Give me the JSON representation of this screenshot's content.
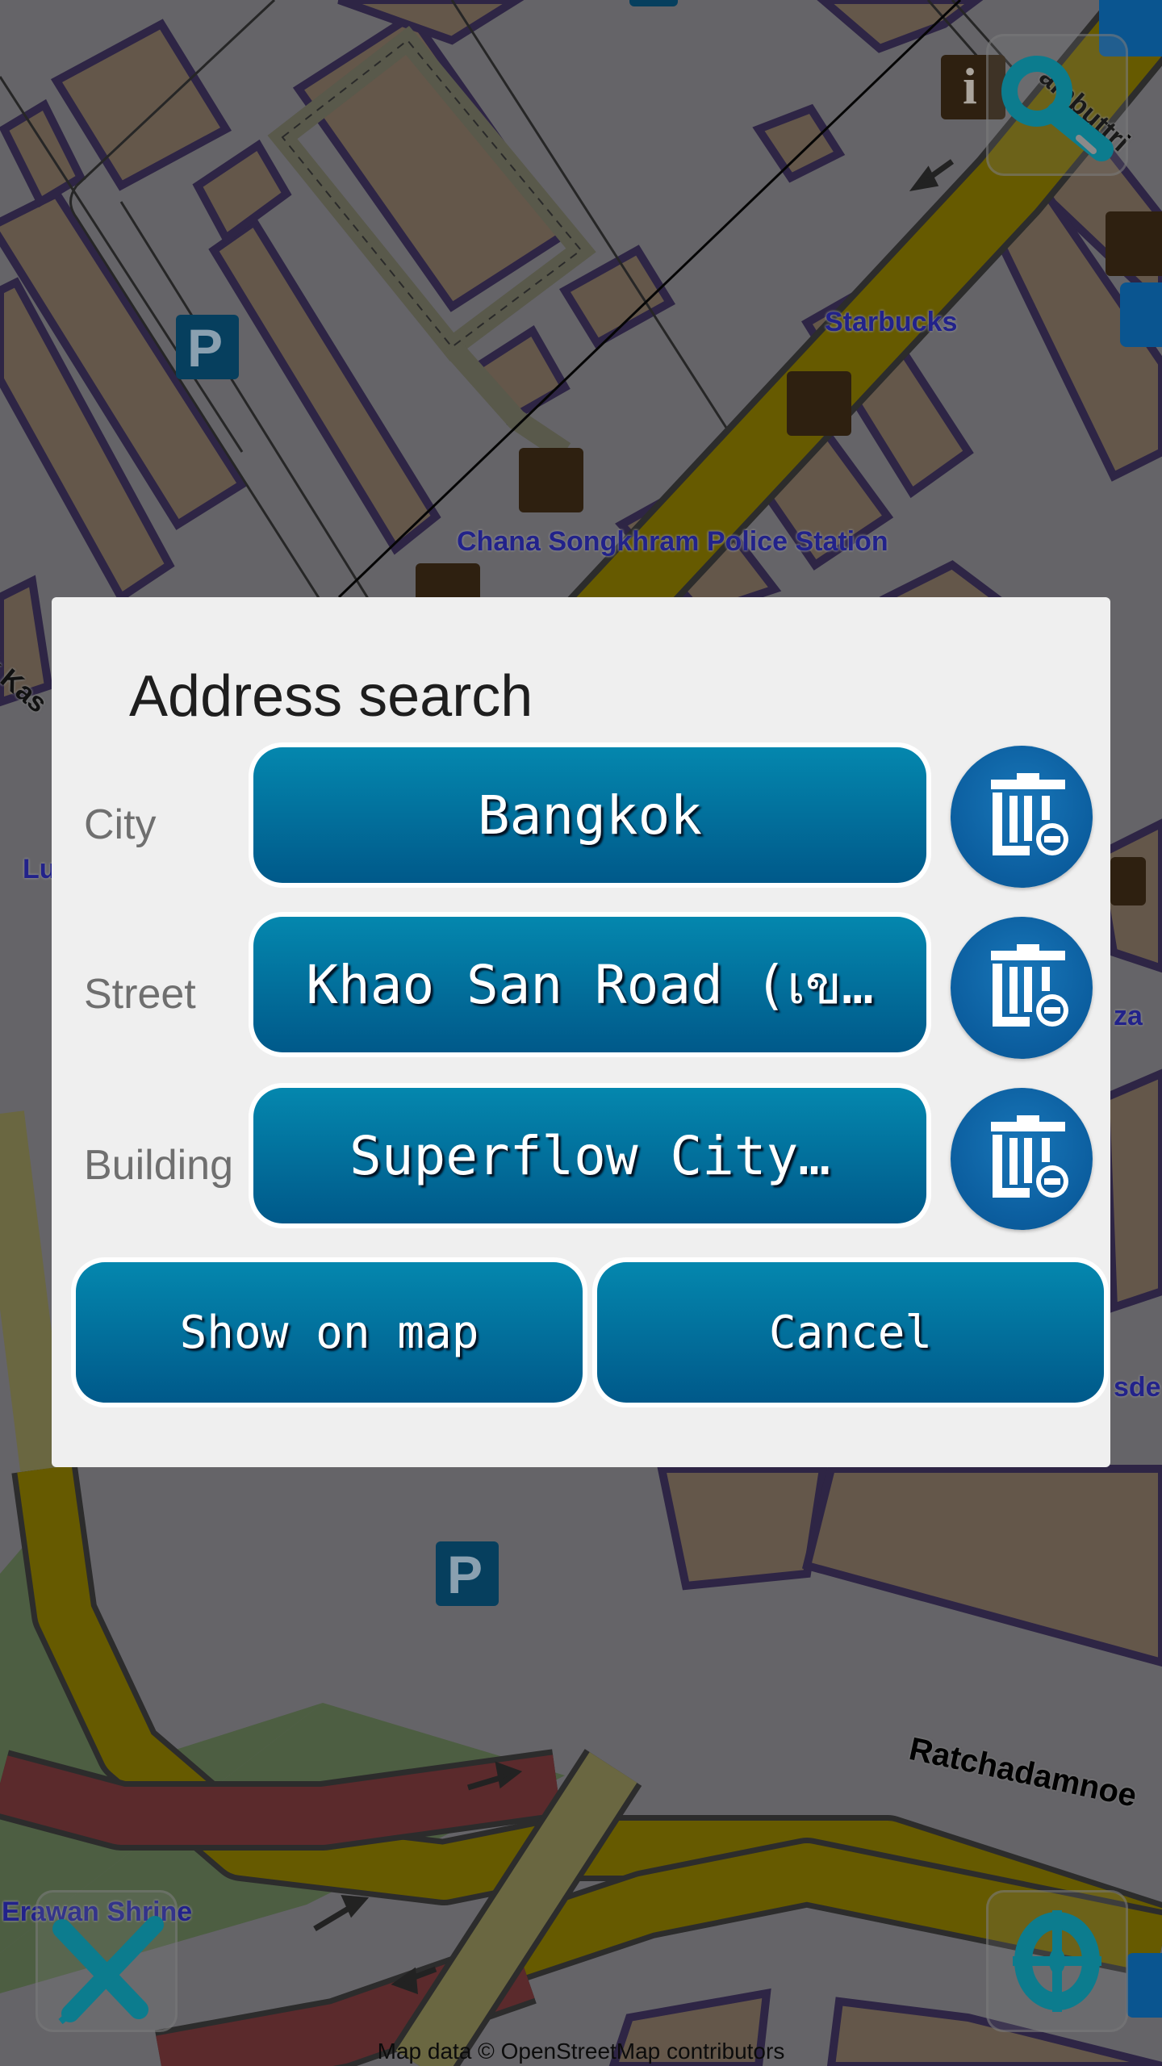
{
  "map": {
    "poi_labels": [
      {
        "id": "starbucks",
        "text": "Starbucks"
      },
      {
        "id": "police",
        "text": "Chana Songkhram Police Station"
      },
      {
        "id": "erawan",
        "text": "Erawan Shrine"
      },
      {
        "id": "lu",
        "text": "Lu"
      },
      {
        "id": "za",
        "text": "za"
      },
      {
        "id": "sde",
        "text": "sde"
      }
    ],
    "road_labels": [
      {
        "id": "ratchadamnoen",
        "text": "Ratchadamnoe"
      },
      {
        "id": "ambuttri",
        "text": "ambuttri"
      },
      {
        "id": "kas",
        "text": "ok Kas"
      }
    ],
    "parking_glyph": "P",
    "info_glyph": "i",
    "attribution": "Map data © OpenStreetMap contributors"
  },
  "overlay_buttons": {
    "search": "search-icon",
    "tools": "ruler-pencil-icon",
    "locate": "locate-icon"
  },
  "dialog": {
    "title": "Address search",
    "fields": [
      {
        "label": "City",
        "value": "Bangkok",
        "clear_icon": "trash-minus-icon"
      },
      {
        "label": "Street",
        "value": "Khao San Road (เข…",
        "clear_icon": "trash-minus-icon"
      },
      {
        "label": "Building",
        "value": "Superflow City…",
        "clear_icon": "trash-minus-icon"
      }
    ],
    "show_on_map_label": "Show on map",
    "cancel_label": "Cancel"
  },
  "colors": {
    "button_top": "#0487ae",
    "button_bottom": "#00598a",
    "clear_button": "#0b5d9e",
    "dialog_bg": "#efefef",
    "poi_text": "#22228a"
  }
}
